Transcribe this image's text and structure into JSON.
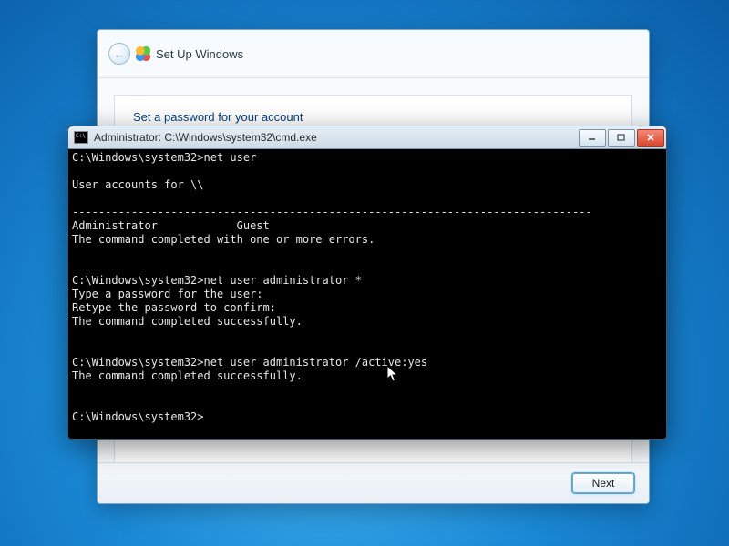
{
  "wizard": {
    "title": "Set Up Windows",
    "inner_heading": "Set a password for your account",
    "next_label": "Next"
  },
  "console": {
    "title": "Administrator: C:\\Windows\\system32\\cmd.exe",
    "lines": [
      "C:\\Windows\\system32>net user",
      "",
      "User accounts for \\\\",
      "",
      "-------------------------------------------------------------------------------",
      "Administrator            Guest",
      "The command completed with one or more errors.",
      "",
      "",
      "C:\\Windows\\system32>net user administrator *",
      "Type a password for the user:",
      "Retype the password to confirm:",
      "The command completed successfully.",
      "",
      "",
      "C:\\Windows\\system32>net user administrator /active:yes",
      "The command completed successfully.",
      "",
      "",
      "C:\\Windows\\system32>"
    ]
  }
}
